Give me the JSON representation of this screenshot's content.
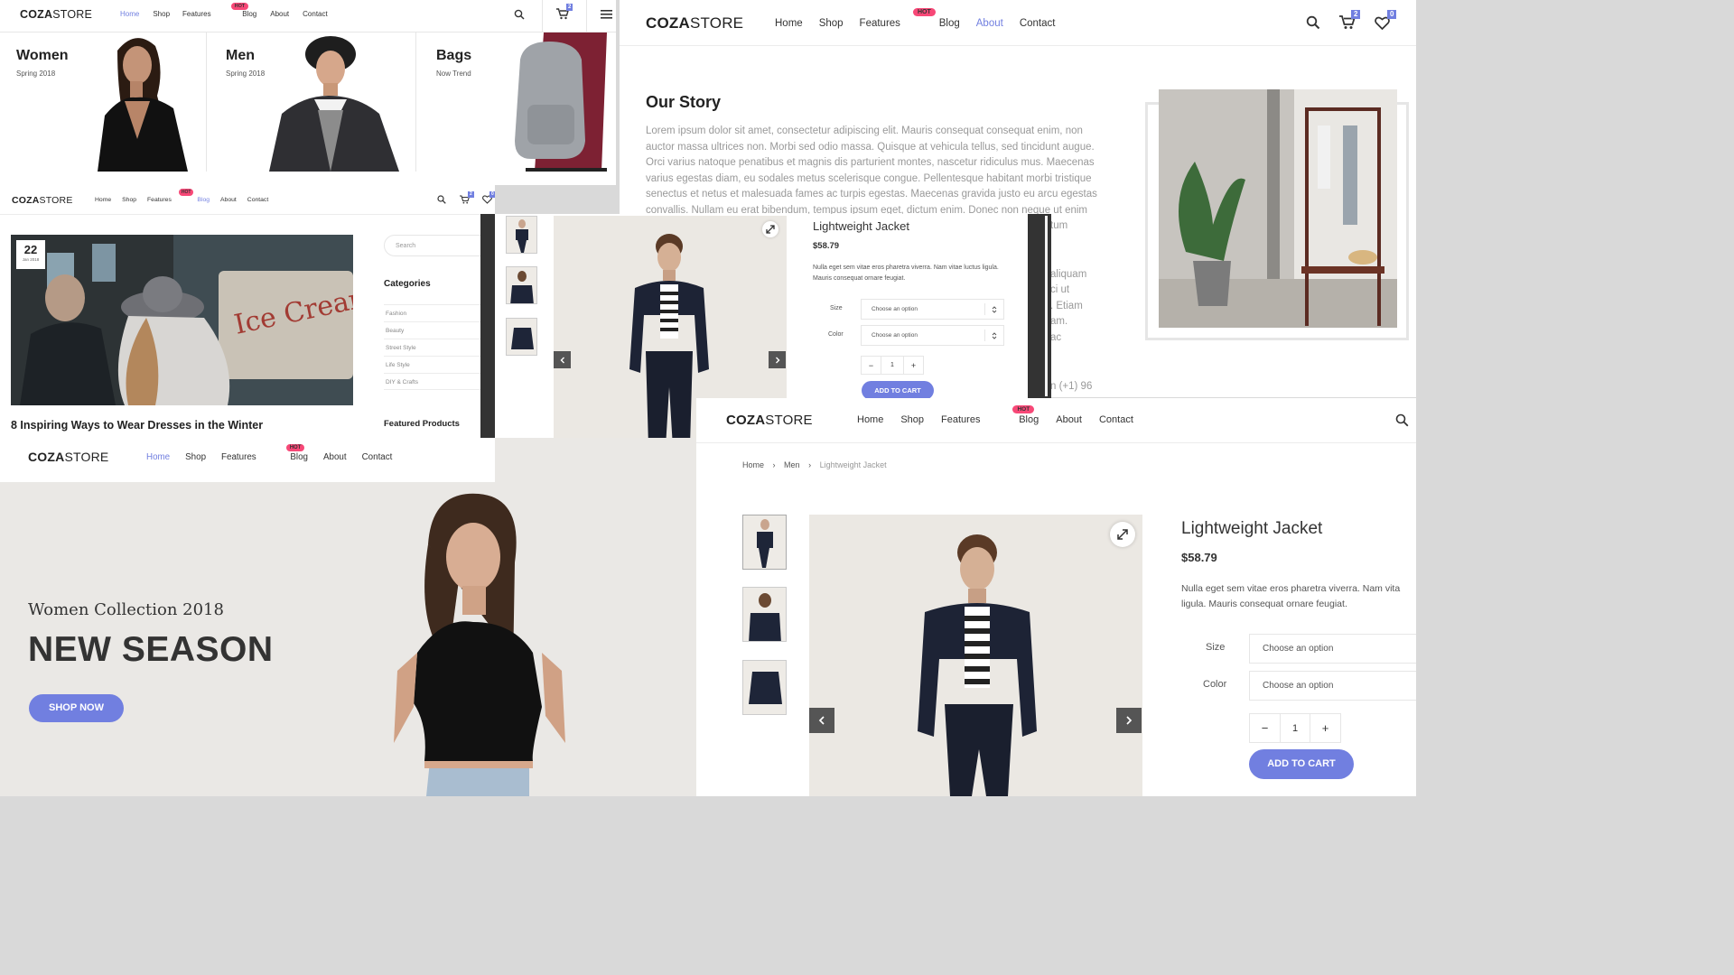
{
  "brand": {
    "bold": "COZA",
    "light": "STORE"
  },
  "hot_label": "HOT",
  "nav": [
    "Home",
    "Shop",
    "Features",
    "Blog",
    "About",
    "Contact"
  ],
  "colors": {
    "accent": "#717fe0",
    "hot": "#f74877",
    "text": "#333333"
  },
  "panel_home": {
    "cart_count": "2",
    "categories": [
      {
        "title": "Women",
        "subtitle": "Spring 2018"
      },
      {
        "title": "Men",
        "subtitle": "Spring 2018"
      },
      {
        "title": "Bags",
        "subtitle": "Now Trend"
      }
    ]
  },
  "panel_about": {
    "cart_count": "2",
    "wishlist_count": "0",
    "heading": "Our Story",
    "body": [
      "Lorem ipsum dolor sit amet, consectetur adipiscing elit. Mauris consequat consequat enim, non",
      "auctor massa ultrices non. Morbi sed odio massa. Quisque at vehicula tellus, sed tincidunt augue.",
      "Orci varius natoque penatibus et magnis dis parturient montes, nascetur ridiculus mus. Maecenas",
      "varius egestas diam, eu sodales metus scelerisque congue. Pellentesque habitant morbi tristique",
      "senectus et netus et malesuada fames ac turpis egestas. Maecenas gravida justo eu arcu egestas",
      "convallis. Nullam eu erat bibendum, tempus ipsum eget, dictum enim. Donec non neque ut enim"
    ],
    "peek": [
      "tum",
      "aliquam",
      "ci ut",
      ". Etiam",
      "am.",
      "ac",
      "n (+1) 96"
    ]
  },
  "panel_blog": {
    "cart_count": "2",
    "wishlist_count": "0",
    "date_day": "22",
    "date_month": "Jan 2018",
    "post_title": "8 Inspiring Ways to Wear Dresses in the Winter",
    "search_placeholder": "Search",
    "categories_heading": "Categories",
    "categories": [
      "Fashion",
      "Beauty",
      "Street Style",
      "Life Style",
      "DIY & Crafts"
    ],
    "featured_heading": "Featured Products"
  },
  "panel_modal": {
    "product_name": "Lightweight Jacket",
    "price": "$58.79",
    "description": "Nulla eget sem vitae eros pharetra viverra. Nam vitae luctus ligula. Mauris consequat ornare feugiat.",
    "size_label": "Size",
    "color_label": "Color",
    "select_placeholder": "Choose an option",
    "qty_minus": "−",
    "qty_value": "1",
    "qty_plus": "+",
    "add_to_cart": "ADD TO CART"
  },
  "panel_hero": {
    "subtitle": "Women Collection 2018",
    "title": "NEW SEASON",
    "cta": "SHOP NOW"
  },
  "panel_product": {
    "breadcrumb": [
      "Home",
      "Men",
      "Lightweight Jacket"
    ],
    "product_name": "Lightweight Jacket",
    "price": "$58.79",
    "description_lines": [
      "Nulla eget sem vitae eros pharetra viverra. Nam vita",
      "ligula. Mauris consequat ornare feugiat."
    ],
    "size_label": "Size",
    "color_label": "Color",
    "select_placeholder": "Choose an option",
    "qty_minus": "−",
    "qty_value": "1",
    "qty_plus": "+",
    "add_to_cart": "ADD TO CART"
  }
}
